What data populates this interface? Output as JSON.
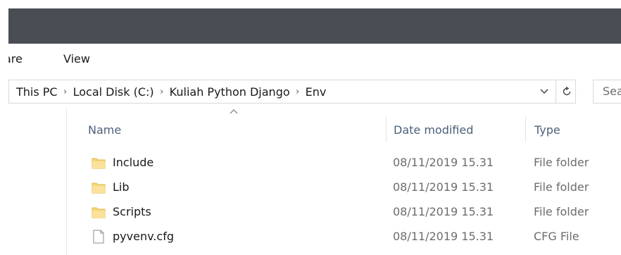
{
  "window": {
    "titlebar_color": "#4a4e54"
  },
  "ribbon": {
    "tabs": [
      "Share",
      "View"
    ],
    "share_visible": "are",
    "view": "View"
  },
  "address": {
    "crumbs": [
      "This PC",
      "Local Disk (C:)",
      "Kuliah Python Django",
      "Env"
    ],
    "dropdown_icon": "chevron-down-icon",
    "refresh_icon": "refresh-icon"
  },
  "search": {
    "placeholder": "Sea"
  },
  "columns": {
    "name": "Name",
    "date": "Date modified",
    "type": "Type"
  },
  "files": [
    {
      "name": "Include",
      "date": "08/11/2019 15.31",
      "type": "File folder",
      "icon": "folder-icon"
    },
    {
      "name": "Lib",
      "date": "08/11/2019 15.31",
      "type": "File folder",
      "icon": "folder-icon"
    },
    {
      "name": "Scripts",
      "date": "08/11/2019 15.31",
      "type": "File folder",
      "icon": "folder-icon"
    },
    {
      "name": "pyvenv.cfg",
      "date": "08/11/2019 15.31",
      "type": "CFG File",
      "icon": "file-icon"
    }
  ],
  "colors": {
    "folder": "#f8d775",
    "header_text": "#4c607a",
    "meta_text": "#6d6d6d"
  }
}
